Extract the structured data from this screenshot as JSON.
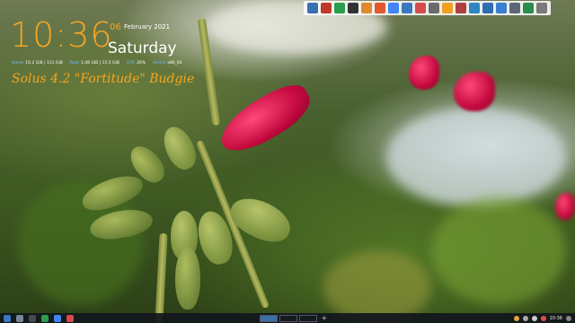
{
  "clock": {
    "time": "10:36",
    "day_number": "06",
    "month_year": "February 2021",
    "weekday": "Saturday"
  },
  "stats": [
    {
      "key": "Home",
      "value": "10.2 GiB | 111 GiB"
    },
    {
      "key": "Root",
      "value": "1.08 GiB | 15.5 GiB"
    },
    {
      "key": "CPU",
      "value": "26%"
    },
    {
      "key": "Kernel",
      "value": "x86_64"
    }
  ],
  "distro_label": "Solus 4.2 \"Fortitude\" Budgie",
  "top_panel": {
    "icons": [
      {
        "name": "window-icon",
        "color": "#3b6fb6"
      },
      {
        "name": "app-icon-red",
        "color": "#c0392b"
      },
      {
        "name": "green-icon",
        "color": "#2a9d4e"
      },
      {
        "name": "terminal-icon",
        "color": "#333333"
      },
      {
        "name": "folder-icon",
        "color": "#e08a2e"
      },
      {
        "name": "firefox-icon",
        "color": "#e05a2e"
      },
      {
        "name": "chrome-icon",
        "color": "#4285f4"
      },
      {
        "name": "settings-icon",
        "color": "#3b78c2"
      },
      {
        "name": "store-icon",
        "color": "#d64c4c"
      },
      {
        "name": "tool-icon",
        "color": "#6a6a6a"
      },
      {
        "name": "sun-icon",
        "color": "#f0a020"
      },
      {
        "name": "music-icon",
        "color": "#b04040"
      },
      {
        "name": "screen-icon",
        "color": "#2e86c1"
      },
      {
        "name": "blue-icon",
        "color": "#2f6db5"
      },
      {
        "name": "mail-icon",
        "color": "#3a7ed0"
      },
      {
        "name": "monitor-icon",
        "color": "#5b6776"
      },
      {
        "name": "check-icon",
        "color": "#2c8c50"
      },
      {
        "name": "trash-icon",
        "color": "#7a7a7a"
      }
    ]
  },
  "bottom_panel": {
    "launchers": [
      {
        "name": "menu-icon",
        "color": "#3b78c2"
      },
      {
        "name": "files-icon",
        "color": "#7a8897"
      },
      {
        "name": "terminal-icon",
        "color": "#444a52"
      },
      {
        "name": "software-icon",
        "color": "#2a9d4e"
      },
      {
        "name": "browser-icon",
        "color": "#4285f4"
      },
      {
        "name": "media-icon",
        "color": "#d64c4c"
      }
    ],
    "workspace_count": 3,
    "workspace_add": "+",
    "tray": {
      "time": "10:36"
    }
  }
}
